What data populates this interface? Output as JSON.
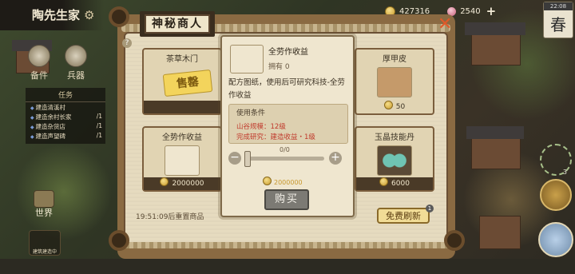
{
  "town": {
    "name": "陶先生家"
  },
  "left_menu": [
    {
      "label": "备件"
    },
    {
      "label": "兵器"
    }
  ],
  "tasks": {
    "title": "任务",
    "items": [
      {
        "text": "建造清溪村",
        "count": ""
      },
      {
        "text": "建造余村长家",
        "count": "/1"
      },
      {
        "text": "建造杂货店",
        "count": "/1"
      },
      {
        "text": "建造声望碑",
        "count": "/1"
      }
    ]
  },
  "world_button": {
    "label": "世界"
  },
  "build_button": {
    "label": "建筑建造中"
  },
  "resources": {
    "coins": "427316",
    "pearls": "2540",
    "plus": "+"
  },
  "season": {
    "time": "22:08",
    "char": "春"
  },
  "right_widget": {
    "count": "3"
  },
  "shop": {
    "title": "神秘商人",
    "help": "?",
    "close": "✕",
    "timer_text": "19:51:09后重置商品",
    "refresh_label": "免费刷新",
    "refresh_badge": "1",
    "sold_label": "售罄",
    "cards": [
      {
        "name": "茶草木门",
        "price": "",
        "sold": true
      },
      {
        "name": "全势作收益",
        "price": "2000000",
        "sold": false
      },
      {
        "name": "厚甲皮",
        "price": "50",
        "sold": false
      },
      {
        "name": "玉晶技能丹",
        "price": "6000",
        "sold": false
      }
    ]
  },
  "detail": {
    "name": "全劳作收益",
    "owned": "拥有 0",
    "desc": "配方图纸，使用后可研究科技-全劳作收益",
    "cond_title": "使用条件",
    "req1": "山谷规模：12级",
    "req2": "完成研究：建造收益・1级",
    "qty": "0/0",
    "minus": "−",
    "plus": "+",
    "cost": "2000000",
    "buy_label": "购买"
  },
  "colors": {
    "frame": "#8a6a42",
    "panel": "#e6dbbf",
    "accent_red": "#c0392b",
    "gold": "#c7972c"
  }
}
